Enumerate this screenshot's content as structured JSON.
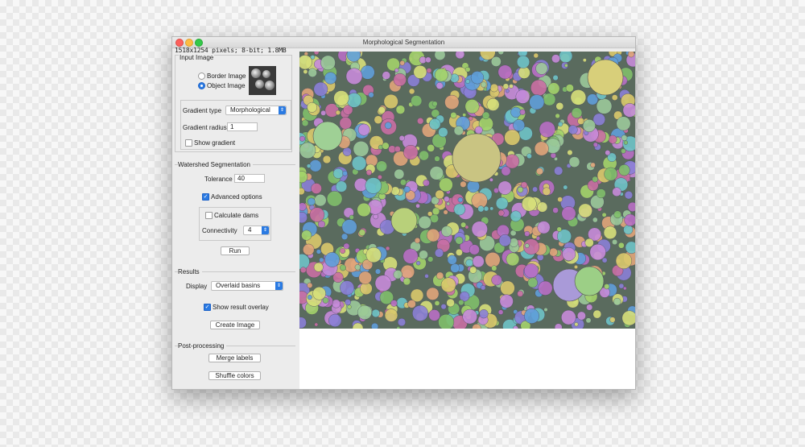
{
  "window": {
    "title": "Morphological Segmentation",
    "info": "1518x1254 pixels; 8-bit; 1.8MB"
  },
  "input_image": {
    "section_label": "Input Image",
    "radio_border_label": "Border Image",
    "radio_object_label": "Object Image",
    "selected": "Object Image",
    "gradient_type_label": "Gradient type",
    "gradient_type_value": "Morphological",
    "gradient_radius_label": "Gradient radius",
    "gradient_radius_value": "1",
    "show_gradient_label": "Show gradient",
    "show_gradient_checked": false
  },
  "watershed": {
    "section_label": "Watershed Segmentation",
    "tolerance_label": "Tolerance",
    "tolerance_value": "40",
    "advanced_label": "Advanced options",
    "advanced_checked": true,
    "dams_label": "Calculate dams",
    "dams_checked": false,
    "connectivity_label": "Connectivity",
    "connectivity_value": "4",
    "run_label": "Run"
  },
  "results": {
    "section_label": "Results",
    "display_label": "Display",
    "display_value": "Overlaid basins",
    "overlay_label": "Show result overlay",
    "overlay_checked": true,
    "create_image_label": "Create Image"
  },
  "post": {
    "section_label": "Post-processing",
    "merge_label": "Merge labels",
    "shuffle_label": "Shuffle colors"
  },
  "colors": {
    "accent": "#2a7ae2",
    "close": "#fc605c",
    "minimize": "#fdbc40",
    "zoom": "#34c84a"
  }
}
